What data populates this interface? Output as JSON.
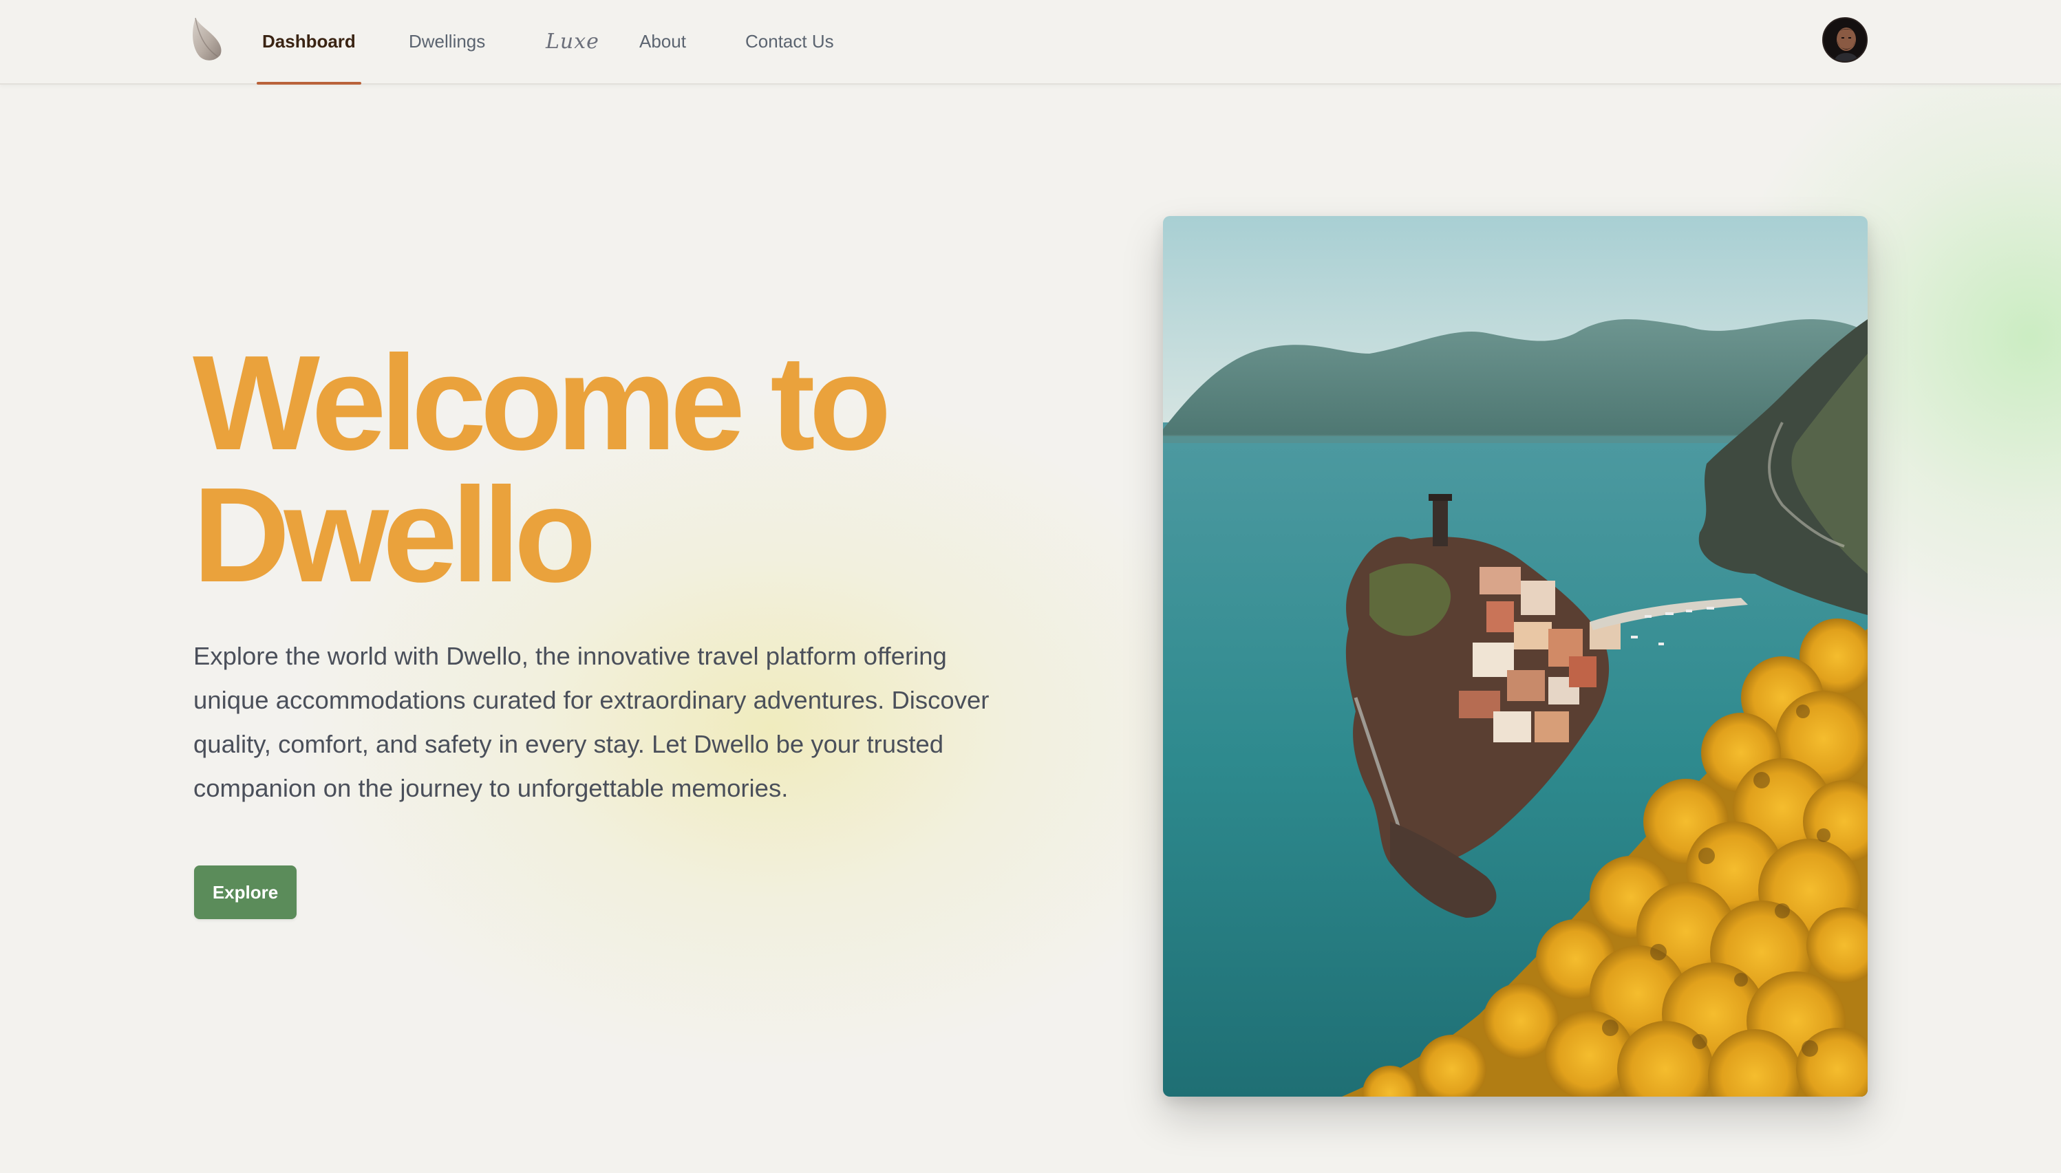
{
  "brand": {
    "logo_icon": "feather-leaf-icon"
  },
  "nav": {
    "items": [
      {
        "label": "Dashboard",
        "active": true
      },
      {
        "label": "Dwellings",
        "active": false
      },
      {
        "label": "Luxe",
        "active": false
      },
      {
        "label": "About",
        "active": false
      },
      {
        "label": "Contact Us",
        "active": false
      }
    ],
    "avatar_icon": "user-avatar"
  },
  "hero": {
    "title_line1": "Welcome to",
    "title_line2": "Dwello",
    "description_lines": [
      "Explore the world with Dwello, the innovative travel platform offering",
      "unique accommodations curated for extraordinary adventures. Discover",
      "quality, comfort, and safety in every stay. Let Dwello be your trusted",
      "companion on the journey to unforgettable memories."
    ],
    "cta_label": "Explore",
    "image_subject": "coastal-cliff-village-photo"
  },
  "colors": {
    "background": "#f3f2ee",
    "title": "#eaa23c",
    "body_text": "#4a4f5a",
    "button": "#5b8c5a",
    "nav_active_underline": "#b9623a",
    "nav_active_text": "#3a2413"
  }
}
